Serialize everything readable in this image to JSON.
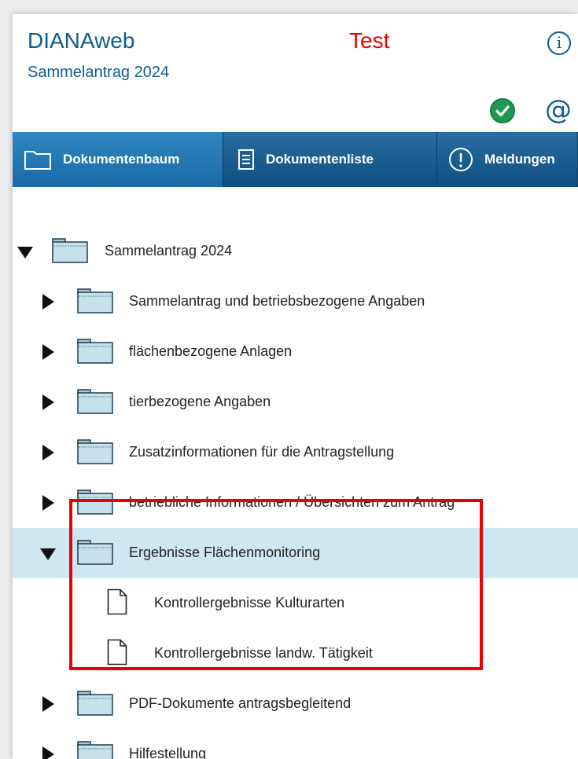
{
  "header": {
    "app_title": "DIANAweb",
    "subtitle": "Sammelantrag 2024",
    "environment": "Test",
    "environment_color": "#ee0000",
    "info_icon": "info-icon",
    "status_icon": "check-circle-icon",
    "mail_icon": "at-icon"
  },
  "tabs": [
    {
      "label": "Dokumentenbaum",
      "icon": "folder-outline-icon",
      "active": true
    },
    {
      "label": "Dokumentenliste",
      "icon": "document-list-icon",
      "active": false
    },
    {
      "label": "Meldungen",
      "icon": "exclamation-circle-icon",
      "active": false
    }
  ],
  "tree": {
    "root": {
      "label": "Sammelantrag 2024",
      "expanded": true
    },
    "items": [
      {
        "label": "Sammelantrag und betriebsbezogene Angaben",
        "expanded": false
      },
      {
        "label": "flächenbezogene Anlagen",
        "expanded": false
      },
      {
        "label": "tierbezogene Angaben",
        "expanded": false
      },
      {
        "label": "Zusatzinformationen für die Antragstellung",
        "expanded": false
      },
      {
        "label": "betriebliche Informationen / Übersichten zum Antrag",
        "expanded": false
      },
      {
        "label": "Ergebnisse Flächenmonitoring",
        "expanded": true,
        "selected": true,
        "children": [
          {
            "label": "Kontrollergebnisse Kulturarten"
          },
          {
            "label": "Kontrollergebnisse landw. Tätigkeit"
          }
        ]
      },
      {
        "label": "PDF-Dokumente antragsbegleitend",
        "expanded": false
      },
      {
        "label": "Hilfestellung",
        "expanded": false
      }
    ]
  },
  "colors": {
    "brand_blue": "#0f5c8c",
    "tab_bar": "#1a6aa6",
    "selected_row": "#cde8f3",
    "highlight": "#ee0000"
  }
}
